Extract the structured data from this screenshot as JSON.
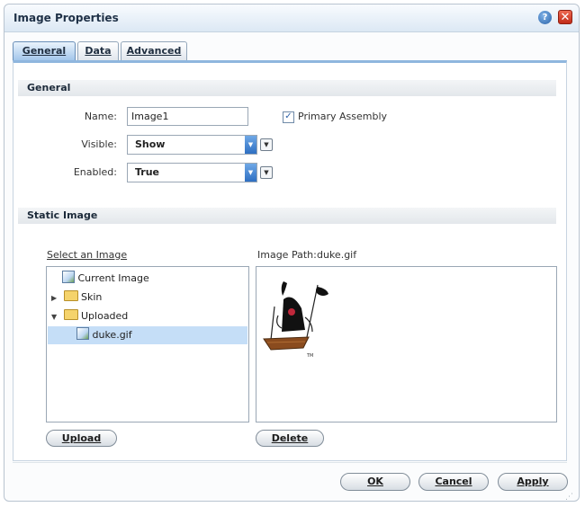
{
  "window": {
    "title": "Image Properties",
    "help_icon": "help-icon",
    "close_icon": "close-icon"
  },
  "tabs": [
    {
      "label": "General",
      "active": true
    },
    {
      "label": "Data",
      "active": false
    },
    {
      "label": "Advanced",
      "active": false
    }
  ],
  "general": {
    "section_title": "General",
    "name_label": "Name:",
    "name_value": "Image1",
    "primary_assembly_label": "Primary Assembly",
    "primary_assembly_checked": true,
    "visible_label": "Visible:",
    "visible_value": "Show",
    "enabled_label": "Enabled:",
    "enabled_value": "True"
  },
  "static_image": {
    "section_title": "Static Image",
    "select_label": "Select an Image",
    "path_label": "Image Path:",
    "path_value": "duke.gif",
    "tree": [
      {
        "label": "Current Image",
        "icon": "image-icon",
        "level": 1
      },
      {
        "label": "Skin",
        "icon": "folder-icon",
        "level": 0,
        "expanded": false
      },
      {
        "label": "Uploaded",
        "icon": "folder-icon",
        "level": 0,
        "expanded": true
      },
      {
        "label": "duke.gif",
        "icon": "image-icon",
        "level": 2,
        "selected": true
      }
    ],
    "upload_label": "Upload",
    "delete_label": "Delete"
  },
  "footer": {
    "ok_label": "OK",
    "cancel_label": "Cancel",
    "apply_label": "Apply"
  }
}
